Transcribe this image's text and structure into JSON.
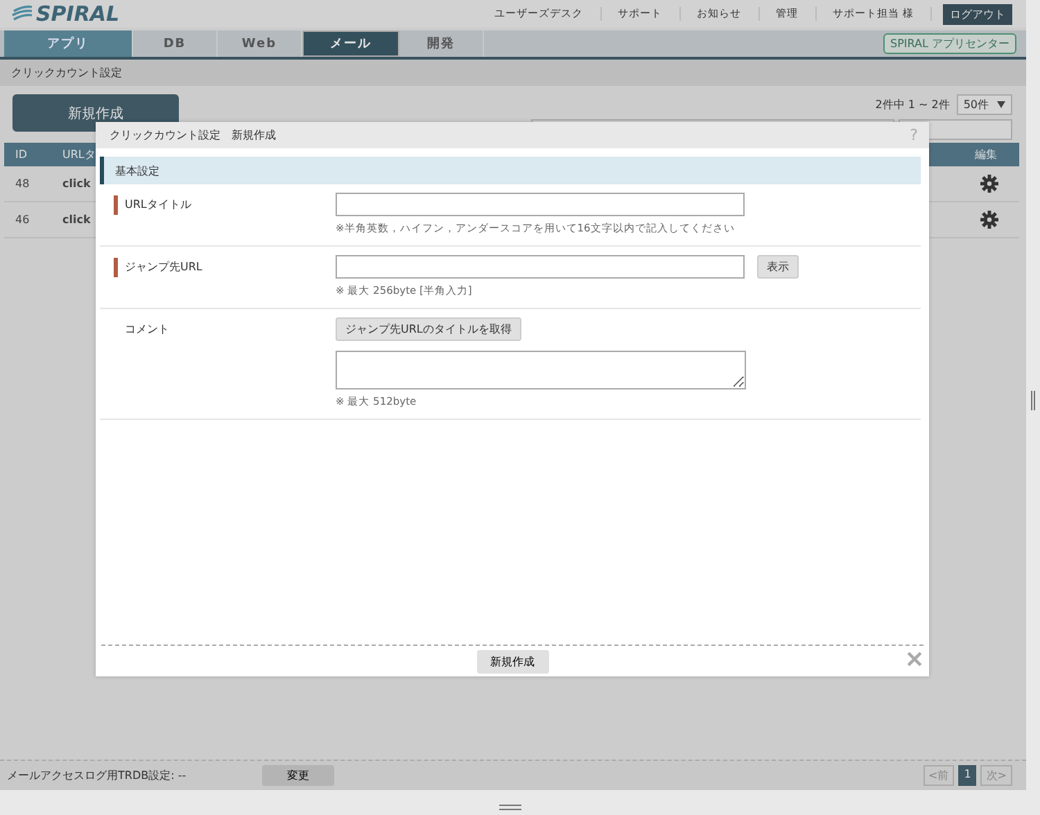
{
  "header": {
    "logo": "SPIRAL",
    "links": [
      "ユーザーズデスク",
      "サポート",
      "お知らせ",
      "管理",
      "サポート担当 様"
    ],
    "logout": "ログアウト"
  },
  "tabs": [
    {
      "label": "アプリ",
      "selected": false,
      "highlighted": true
    },
    {
      "label": "DB",
      "selected": false,
      "highlighted": false
    },
    {
      "label": "Web",
      "selected": false,
      "highlighted": false
    },
    {
      "label": "メール",
      "selected": true,
      "highlighted": false
    },
    {
      "label": "開発",
      "selected": false,
      "highlighted": false
    }
  ],
  "app_center": "SPIRAL アプリセンター",
  "breadcrumb": "クリックカウント設定",
  "toolbar": {
    "new_button": "新規作成",
    "count": "2件中 1 ~ 2件",
    "per_page": "50件"
  },
  "table": {
    "columns": [
      "ID",
      "URLタ",
      "編集"
    ],
    "rows": [
      {
        "id": "48",
        "title": "click"
      },
      {
        "id": "46",
        "title": "click"
      }
    ]
  },
  "bottom_bar": {
    "setting": "メールアクセスログ用TRDB設定: --",
    "change_button": "変更",
    "prev": "<前",
    "page": "1",
    "next": "次>"
  },
  "dialog": {
    "title": "クリックカウント設定　新規作成",
    "help": "?",
    "section": "基本設定",
    "fields": [
      {
        "kind": "input",
        "label": "URLタイトル",
        "required": true,
        "hint": "※半角英数，ハイフン，アンダースコアを用いて16文字以内で記入してください"
      },
      {
        "kind": "input",
        "label": "ジャンプ先URL",
        "required": true,
        "button": "表示",
        "hint": "※ 最大 256byte [半角入力]"
      },
      {
        "kind": "textarea",
        "label": "コメント",
        "required": false,
        "button": "ジャンプ先URLのタイトルを取得",
        "hint": "※ 最大 512byte"
      }
    ],
    "submit": "新規作成"
  }
}
